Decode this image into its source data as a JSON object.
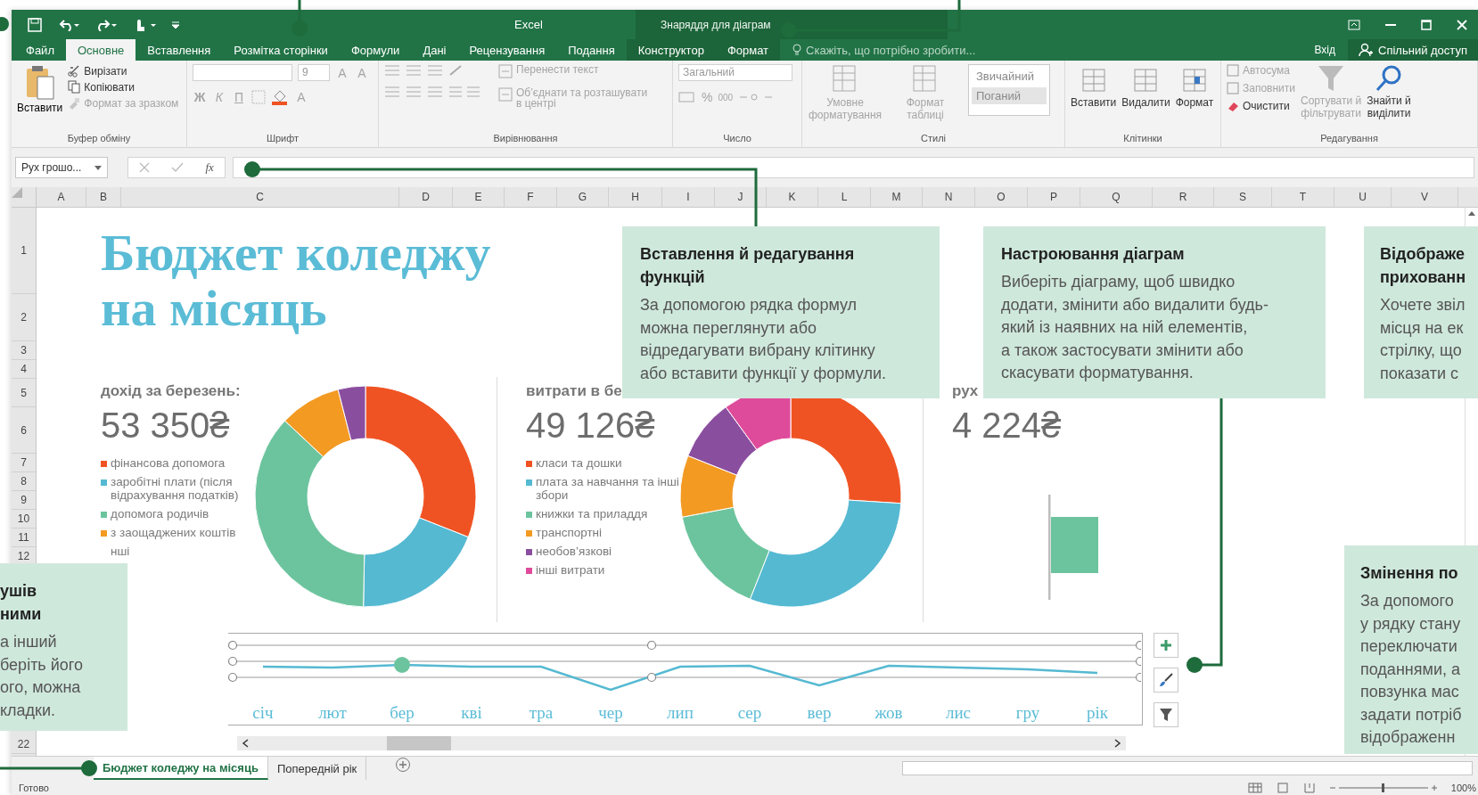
{
  "title_bar": {
    "title": "Excel",
    "context": "Знаряддя для діаграм"
  },
  "tabs": [
    {
      "label": "Файл",
      "selected": false,
      "kind": "normal"
    },
    {
      "label": "Основне",
      "selected": true,
      "kind": "normal"
    },
    {
      "label": "Вставлення",
      "selected": false,
      "kind": "normal"
    },
    {
      "label": "Розмітка сторінки",
      "selected": false,
      "kind": "normal"
    },
    {
      "label": "Формули",
      "selected": false,
      "kind": "normal"
    },
    {
      "label": "Дані",
      "selected": false,
      "kind": "normal"
    },
    {
      "label": "Рецензування",
      "selected": false,
      "kind": "normal"
    },
    {
      "label": "Подання",
      "selected": false,
      "kind": "normal"
    },
    {
      "label": "Конструктор",
      "selected": false,
      "kind": "context"
    },
    {
      "label": "Формат",
      "selected": false,
      "kind": "context"
    }
  ],
  "tell_me": {
    "placeholder": "Скажіть, що потрібно зробити..."
  },
  "sign_in": "Вхід",
  "share": "Спільний доступ",
  "ribbon_groups": [
    {
      "kind": "clipboard",
      "label": "Буфер обміну",
      "items": [
        {
          "label": "Вставити",
          "disabled": false
        },
        {
          "label": "Вирізати",
          "disabled": false
        },
        {
          "label": "Копіювати",
          "disabled": false
        },
        {
          "label": "Формат за зразком",
          "disabled": true
        }
      ]
    },
    {
      "kind": "font",
      "label": "Шрифт",
      "size": "9",
      "buttons": [
        {
          "text": "A",
          "kind": "grow",
          "disabled": true
        },
        {
          "text": "A",
          "kind": "shrink",
          "disabled": true
        },
        {
          "text": "Ж",
          "kind": "bold",
          "disabled": true
        },
        {
          "text": "К",
          "kind": "italic",
          "disabled": true
        },
        {
          "text": "П",
          "kind": "underline",
          "disabled": true
        },
        {
          "text": "A",
          "kind": "color",
          "disabled": true
        }
      ]
    },
    {
      "kind": "alignment",
      "label": "Вирівнювання",
      "items": [
        {
          "label": "Перенести текст",
          "disabled": true
        },
        {
          "label": "Об’єднати та розташувати\nв центрі",
          "disabled": true
        }
      ]
    },
    {
      "kind": "number",
      "label": "Число",
      "format": "Загальний",
      "buttons": [
        {
          "text": "%",
          "disabled": true
        },
        {
          "text": "000",
          "disabled": true
        }
      ]
    },
    {
      "kind": "styles",
      "label": "Стилі",
      "items": [
        {
          "label": "Умовне\nформатування",
          "disabled": true
        },
        {
          "label": "Формат\nтаблиці",
          "disabled": true
        }
      ],
      "styles": [
        {
          "label": "Звичайний",
          "kind": "normal"
        },
        {
          "label": "Поганий",
          "kind": "bad"
        }
      ]
    },
    {
      "kind": "cells",
      "label": "Клітинки",
      "items": [
        {
          "label": "Вставити",
          "disabled": false
        },
        {
          "label": "Видалити",
          "disabled": false
        },
        {
          "label": "Формат",
          "disabled": false
        }
      ]
    },
    {
      "kind": "editing",
      "label": "Редагування",
      "small": [
        {
          "label": "Автосума",
          "disabled": true
        },
        {
          "label": "Заповнити",
          "disabled": true
        },
        {
          "label": "Очистити",
          "disabled": false
        }
      ],
      "large": [
        {
          "label": "Сортувати й\nфільтрувати",
          "disabled": true
        },
        {
          "label": "Знайти й\nвиділити",
          "disabled": false
        }
      ]
    }
  ],
  "formula_bar": {
    "name_box": "Рух грошо...",
    "function_label": "fx"
  },
  "columns": [
    "A",
    "B",
    "C",
    "D",
    "E",
    "F",
    "G",
    "H",
    "I",
    "J",
    "K",
    "L",
    "M",
    "N",
    "O",
    "P",
    "Q",
    "R",
    "S",
    "T",
    "U",
    "V"
  ],
  "rows": [
    "1",
    "2",
    "3",
    "4",
    "5",
    "6",
    "7",
    "8",
    "9",
    "10",
    "11",
    "12",
    "22"
  ],
  "sheet": {
    "title": "Бюджет коледжу\nна місяць",
    "panels": [
      {
        "kind": "donut",
        "heading": "дохід за березень:",
        "value": "53 350₴",
        "legend": [
          {
            "label": "фінансова допомога",
            "color": "#f05323"
          },
          {
            "label": "заробітні плати (після відрахування податків)",
            "color": "#55b9d2"
          },
          {
            "label": "допомога родичів",
            "color": "#6cc49e"
          },
          {
            "label": "з заощаджених коштів",
            "color": "#f39a23"
          },
          {
            "label": "нші"
          }
        ]
      },
      {
        "kind": "donut",
        "heading": "витрати в бе",
        "value": "49 126₴",
        "legend": [
          {
            "label": "класи та дошки",
            "color": "#f05323"
          },
          {
            "label": "плата за навчання та інші збори",
            "color": "#55b9d2"
          },
          {
            "label": "книжки та приладдя",
            "color": "#6cc49e"
          },
          {
            "label": "транспортні",
            "color": "#f39a23"
          },
          {
            "label": "необов’язкові",
            "color": "#8a4e9f"
          },
          {
            "label": "інші витрати",
            "color": "#df4b9b"
          }
        ]
      },
      {
        "kind": "bar",
        "heading": "рух",
        "value": "4 224₴"
      }
    ],
    "months": [
      "січ",
      "лют",
      "бер",
      "кві",
      "тра",
      "чер",
      "лип",
      "сер",
      "вер",
      "жов",
      "лис",
      "гру",
      "рік"
    ]
  },
  "sheet_tabs": [
    {
      "label": "Бюджет коледжу на місяць",
      "selected": true
    },
    {
      "label": "Попередній рік",
      "selected": false
    }
  ],
  "status_bar": {
    "text": "Готово",
    "zoom": "100%"
  },
  "callouts": [
    {
      "title": "Вставлення й редагування\nфункцій",
      "body": "За допомогою рядка формул\nможна переглянути або\nвідредагувати вибрану клітинку\nабо вставити функції у формули."
    },
    {
      "title": "Настроювання діаграм",
      "body": "Виберіть діаграму, щоб швидко\nдодати, змінити або видалити будь-\nякий із наявних на ній елементів,\nа також застосувати змінити або\nскасувати форматування."
    },
    {
      "title": "Відображе\nприхованн",
      "body": "Хочете звіл\nмісця на ек\nстрілку, що\nпоказати с"
    },
    {
      "title": "ушів\nними",
      "body": "а інший\nберіть його\nого, можна\nкладки."
    },
    {
      "title": "Змінення по",
      "body": "За допомого\nу рядку стану\nпереключати\nподаннями, а\nповзунка мас\nзадати потріб\nвідображенн"
    }
  ]
}
